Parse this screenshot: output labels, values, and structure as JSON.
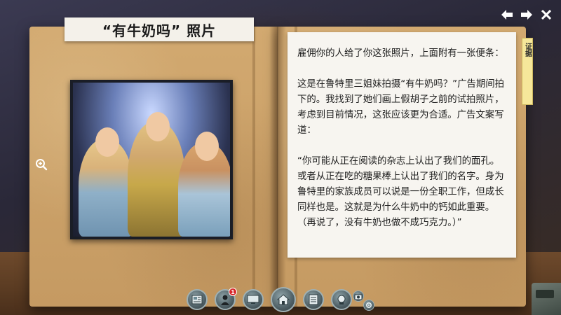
{
  "page": {
    "title": "“有牛奶吗” 照片"
  },
  "note": {
    "paragraphs": [
      "雇佣你的人给了你这张照片，上面附有一张便条：",
      "这是在鲁特里三姐妹拍摄“有牛奶吗？”广告期间拍下的。我找到了她们画上假胡子之前的试拍照片，考虑到目前情况，这张应该更为合适。广告文案写道：",
      "“你可能从正在阅读的杂志上认出了我们的面孔。或者从正在吃的糖果棒上认出了我们的名字。身为鲁特里的家族成员可以说是一份全职工作，但成长同样也是。这就是为什么牛奶中的钙如此重要。（再说了，没有牛奶也做不成巧克力。）”"
    ]
  },
  "evidence_tab": {
    "label": "证据"
  },
  "toolbar": {
    "notification_count": "1"
  },
  "icons": {
    "back": "arrow-left-icon",
    "forward": "arrow-right-icon",
    "close": "close-icon",
    "zoom": "zoom-in-icon",
    "toolbar": [
      "case-file-icon",
      "suspect-icon",
      "computer-icon",
      "home-icon",
      "notes-icon",
      "hint-icon",
      "camera-icon",
      "gear-icon"
    ]
  },
  "colors": {
    "folder": "#c9a06a",
    "note_bg": "#f7f5f0",
    "tab_bg": "#f6e79a",
    "badge": "#d9282b"
  }
}
